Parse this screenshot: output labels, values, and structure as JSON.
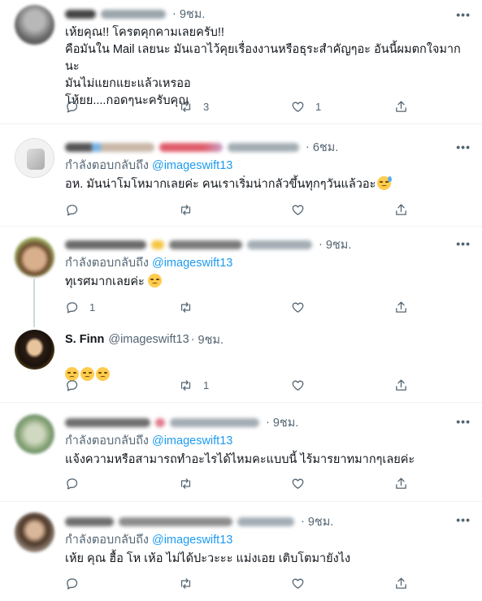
{
  "tweets": [
    {
      "time": "9ชม.",
      "text": "เห้ยคุณ!! โครตคุกคามเลยครับ!!\nคือมันใน Mail เลยนะ มันเอาไว้คุยเรื่องงานหรือธุระสำคัญๆอะ อันนี้ผมตกใจมากนะ\nมันไม่แยกแยะแล้วเหรออ\nโห้ยย....กอดๆนะครับคุณ",
      "retweets": "3",
      "likes": "1"
    },
    {
      "time": "6ชม.",
      "reply_prefix": "กำลังตอบกลับถึง",
      "reply_to": "@imageswift13",
      "text": "อห. มันน่าโมโหมากเลยค่ะ คนเราเริ่มน่ากลัวขึ้นทุกๆวันแล้วอะ"
    },
    {
      "time": "9ชม.",
      "reply_prefix": "กำลังตอบกลับถึง",
      "reply_to": "@imageswift13",
      "text": "ทุเรศมากเลยค่ะ",
      "replies": "1"
    },
    {
      "name": "S. Finn",
      "handle": "@imageswift13",
      "time": "9ชม.",
      "retweets": "1"
    },
    {
      "time": "9ชม.",
      "reply_prefix": "กำลังตอบกลับถึง",
      "reply_to": "@imageswift13",
      "text": "แจ้งความหรือสามารถทำอะไรได้ไหมคะแบบนี้ ไร้มารยาทมากๆเลยค่ะ"
    },
    {
      "time": "9ชม.",
      "reply_prefix": "กำลังตอบกลับถึง",
      "reply_to": "@imageswift13",
      "text": "เห้ย คุณ ฮื้อ โห เห้อ ไม่ได้ปะวะะะ แม่งเอย เติบโตมายังไง"
    }
  ],
  "icons": {
    "reply": "reply-icon",
    "retweet": "retweet-icon",
    "like": "heart-icon",
    "share": "share-icon",
    "more": "more-icon"
  },
  "colors": {
    "accent": "#1d9bf0",
    "secondary_text": "#536471",
    "divider": "#eff3f4"
  }
}
